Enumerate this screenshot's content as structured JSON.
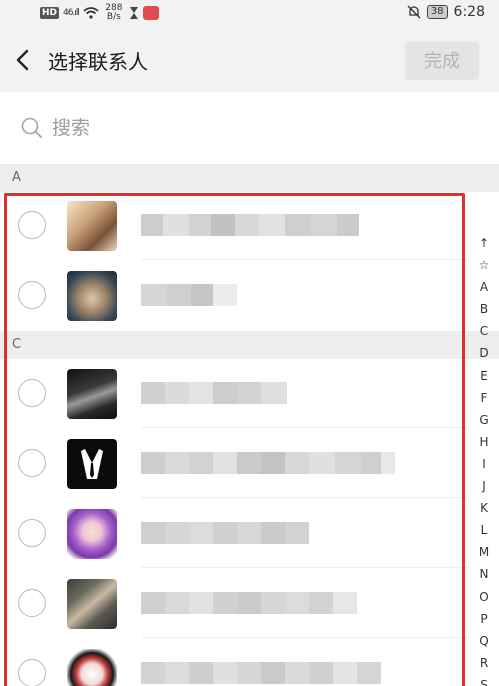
{
  "status_bar": {
    "hd": "HD",
    "signal": "46.ıll",
    "speed_top": "288",
    "speed_bottom": "B/s",
    "battery": "38",
    "time": "6:28"
  },
  "header": {
    "title": "选择联系人",
    "done_label": "完成"
  },
  "search": {
    "placeholder": "搜索"
  },
  "sections": [
    {
      "letter": "A"
    },
    {
      "letter": "C"
    }
  ],
  "index_bar": [
    "↑",
    "☆",
    "A",
    "B",
    "C",
    "D",
    "E",
    "F",
    "G",
    "H",
    "I",
    "J",
    "K",
    "L",
    "M",
    "N",
    "O",
    "P",
    "Q",
    "R",
    "S"
  ],
  "colors": {
    "highlight": "#d9312c",
    "done_disabled": "#b3b3b3",
    "background_bar": "#f2f2f2"
  }
}
